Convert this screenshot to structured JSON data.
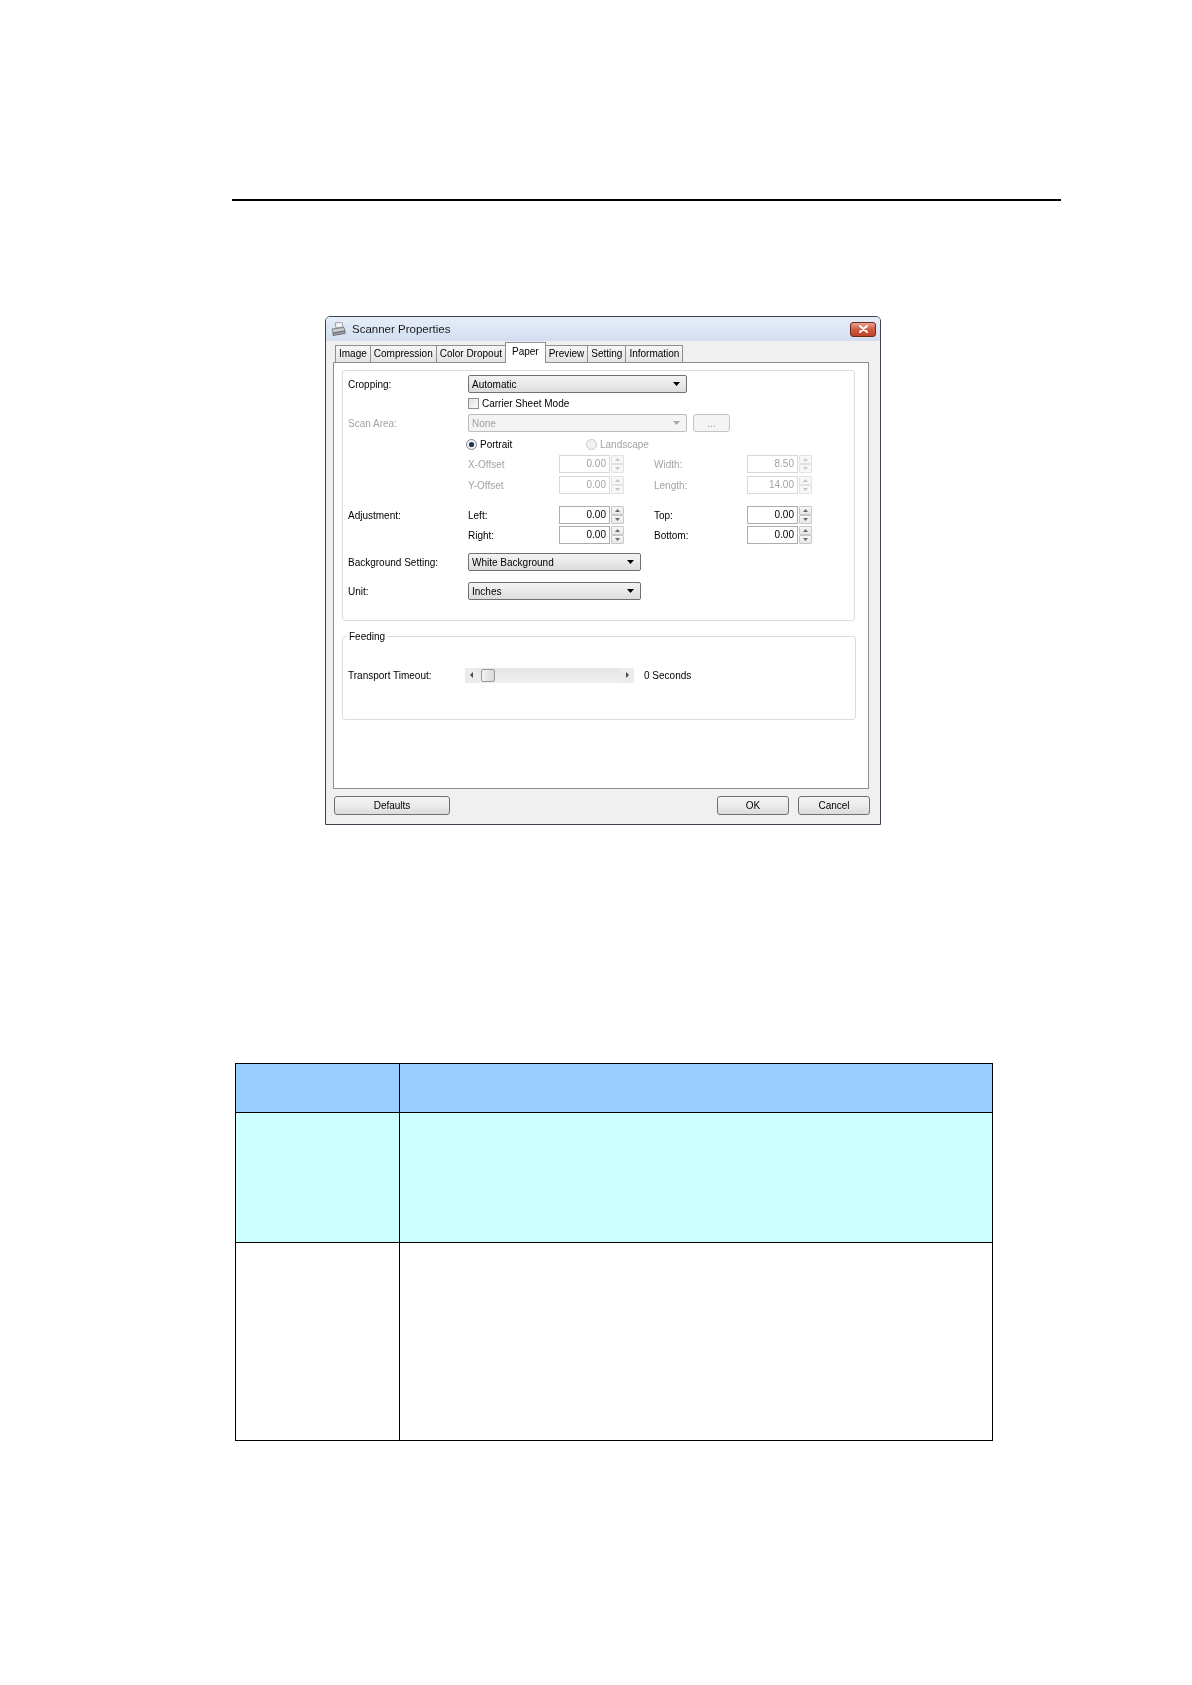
{
  "window": {
    "title": "Scanner Properties"
  },
  "tabs": [
    {
      "label": "Image",
      "selected": false
    },
    {
      "label": "Compression",
      "selected": false
    },
    {
      "label": "Color Dropout",
      "selected": false
    },
    {
      "label": "Paper",
      "selected": true
    },
    {
      "label": "Preview",
      "selected": false
    },
    {
      "label": "Setting",
      "selected": false
    },
    {
      "label": "Information",
      "selected": false
    }
  ],
  "paper": {
    "cropping": {
      "label": "Cropping:",
      "value": "Automatic"
    },
    "carrier_sheet_mode": {
      "label": "Carrier Sheet Mode",
      "checked": false
    },
    "scan_area": {
      "label": "Scan Area:",
      "value": "None",
      "disabled": true,
      "button": "..."
    },
    "orientation": [
      {
        "label": "Portrait",
        "selected": true,
        "disabled": false
      },
      {
        "label": "Landscape",
        "selected": false,
        "disabled": true
      }
    ],
    "size": [
      {
        "label": "X-Offset",
        "value": "0.00",
        "disabled": true
      },
      {
        "label": "Width:",
        "value": "8.50",
        "disabled": true
      },
      {
        "label": "Y-Offset",
        "value": "0.00",
        "disabled": true
      },
      {
        "label": "Length:",
        "value": "14.00",
        "disabled": true
      }
    ],
    "adjustment": {
      "label": "Adjustment:",
      "fields": [
        {
          "label": "Left:",
          "value": "0.00"
        },
        {
          "label": "Top:",
          "value": "0.00"
        },
        {
          "label": "Right:",
          "value": "0.00"
        },
        {
          "label": "Bottom:",
          "value": "0.00"
        }
      ]
    },
    "background_setting": {
      "label": "Background Setting:",
      "value": "White Background"
    },
    "unit": {
      "label": "Unit:",
      "value": "Inches"
    }
  },
  "feeding": {
    "title": "Feeding",
    "transport_timeout": {
      "label": "Transport Timeout:",
      "level": 0,
      "reading": "0 Seconds"
    }
  },
  "buttons": {
    "left": [
      {
        "label": "Defaults"
      }
    ],
    "right": [
      {
        "label": "OK"
      },
      {
        "label": "Cancel"
      }
    ]
  },
  "table": {
    "header": {
      "color": "#99ccff"
    },
    "rows": [
      {
        "color": "#ccffff"
      },
      {
        "color": "#ffffff"
      }
    ]
  }
}
